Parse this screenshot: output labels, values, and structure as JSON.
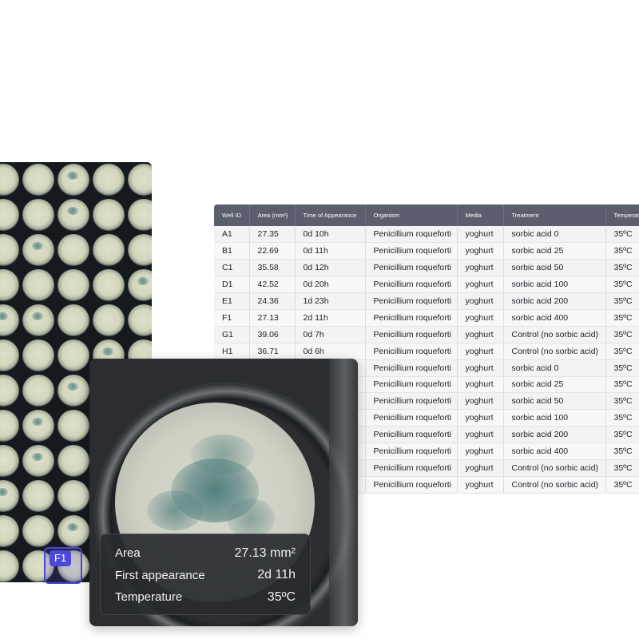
{
  "plate": {
    "selected_well_label": "F1"
  },
  "table": {
    "headers": [
      "Well ID",
      "Area (mm²)",
      "Time of Appearance",
      "Organism",
      "Media",
      "Treatment",
      "Temperature"
    ],
    "rows": [
      [
        "A1",
        "27.35",
        "0d 10h",
        "Penicillium roqueforti",
        "yoghurt",
        "sorbic acid 0",
        "35ºC"
      ],
      [
        "B1",
        "22.69",
        "0d 11h",
        "Penicillium roqueforti",
        "yoghurt",
        "sorbic acid 25",
        "35ºC"
      ],
      [
        "C1",
        "35.58",
        "0d 12h",
        "Penicillium roqueforti",
        "yoghurt",
        "sorbic acid 50",
        "35ºC"
      ],
      [
        "D1",
        "42.52",
        "0d 20h",
        "Penicillium roqueforti",
        "yoghurt",
        "sorbic acid 100",
        "35ºC"
      ],
      [
        "E1",
        "24.36",
        "1d 23h",
        "Penicillium roqueforti",
        "yoghurt",
        "sorbic acid 200",
        "35ºC"
      ],
      [
        "F1",
        "27.13",
        "2d 11h",
        "Penicillium roqueforti",
        "yoghurt",
        "sorbic acid 400",
        "35ºC"
      ],
      [
        "G1",
        "39.06",
        "0d 7h",
        "Penicillium roqueforti",
        "yoghurt",
        "Control (no sorbic acid)",
        "35ºC"
      ],
      [
        "H1",
        "36.71",
        "0d 6h",
        "Penicillium roqueforti",
        "yoghurt",
        "Control (no sorbic acid)",
        "35ºC"
      ],
      [
        "",
        "",
        "",
        "Penicillium roqueforti",
        "yoghurt",
        "sorbic acid 0",
        "35ºC"
      ],
      [
        "",
        "",
        "",
        "Penicillium roqueforti",
        "yoghurt",
        "sorbic acid 25",
        "35ºC"
      ],
      [
        "",
        "",
        "",
        "Penicillium roqueforti",
        "yoghurt",
        "sorbic acid 50",
        "35ºC"
      ],
      [
        "",
        "",
        "",
        "Penicillium roqueforti",
        "yoghurt",
        "sorbic acid 100",
        "35ºC"
      ],
      [
        "",
        "",
        "",
        "Penicillium roqueforti",
        "yoghurt",
        "sorbic acid 200",
        "35ºC"
      ],
      [
        "",
        "",
        "",
        "Penicillium roqueforti",
        "yoghurt",
        "sorbic acid 400",
        "35ºC"
      ],
      [
        "",
        "",
        "",
        "Penicillium roqueforti",
        "yoghurt",
        "Control (no sorbic acid)",
        "35ºC"
      ],
      [
        "",
        "",
        "",
        "Penicillium roqueforti",
        "yoghurt",
        "Control (no sorbic acid)",
        "35ºC"
      ]
    ]
  },
  "zoom": {
    "info": [
      {
        "label": "Area",
        "value": "27.13 mm²"
      },
      {
        "label": "First appearance",
        "value": "2d 11h"
      },
      {
        "label": "Temperature",
        "value": "35ºC"
      }
    ]
  },
  "colors": {
    "accent": "#4b47d8",
    "table_header": "#5b5e6d"
  }
}
